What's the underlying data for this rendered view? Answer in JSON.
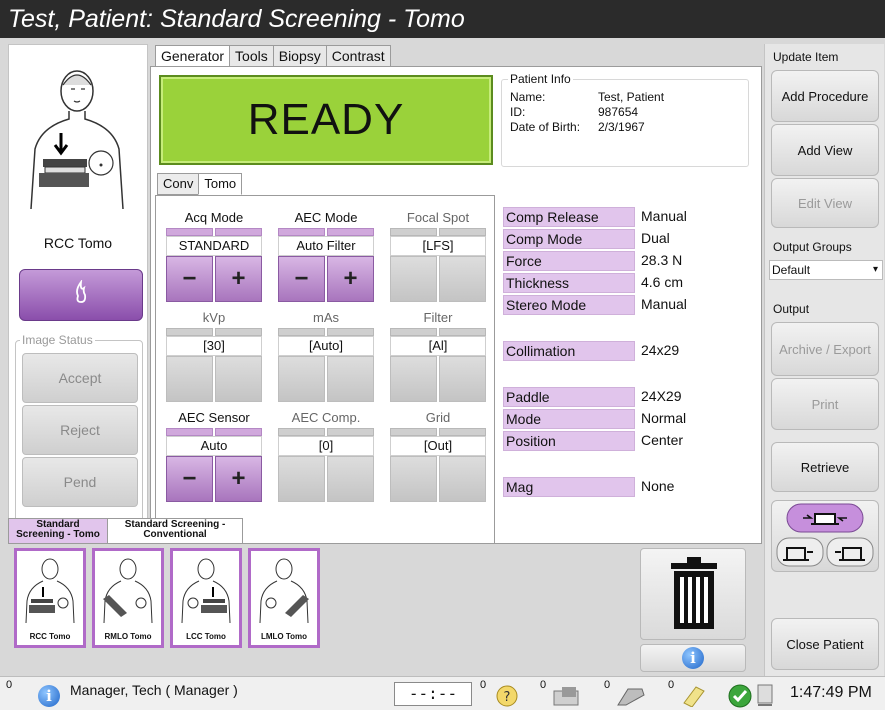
{
  "window": {
    "title": "Test, Patient:  Standard Screening - Tomo"
  },
  "left": {
    "view_name": "RCC Tomo",
    "image_status_label": "Image Status",
    "accept_label": "Accept",
    "reject_label": "Reject",
    "pend_label": "Pend",
    "view_icon": "breast-compression-figure-icon",
    "purple_button_icon": "flame-icon"
  },
  "tabs": [
    "Generator",
    "Tools",
    "Biopsy",
    "Contrast"
  ],
  "ready_text": "READY",
  "patient_info": {
    "legend": "Patient Info",
    "name_label": "Name:",
    "name": "Test, Patient",
    "id_label": "ID:",
    "id": "987654",
    "dob_label": "Date of Birth:",
    "dob": "2/3/1967"
  },
  "subtabs": [
    "Conv",
    "Tomo"
  ],
  "controls": {
    "acq_mode": {
      "label": "Acq Mode",
      "value": "STANDARD"
    },
    "aec_mode": {
      "label": "AEC Mode",
      "value": "Auto Filter"
    },
    "focal_spot": {
      "label": "Focal Spot",
      "value": "[LFS]"
    },
    "kvp": {
      "label": "kVp",
      "value": "[30]"
    },
    "mas": {
      "label": "mAs",
      "value": "[Auto]"
    },
    "filter": {
      "label": "Filter",
      "value": "[Al]"
    },
    "aec_sensor": {
      "label": "AEC Sensor",
      "value": "Auto"
    },
    "aec_comp": {
      "label": "AEC Comp.",
      "value": "[0]"
    },
    "grid": {
      "label": "Grid",
      "value": "[Out]"
    },
    "minus": "−",
    "plus": "+"
  },
  "settings": {
    "comp_release": {
      "k": "Comp Release",
      "v": "Manual"
    },
    "comp_mode": {
      "k": "Comp Mode",
      "v": "Dual"
    },
    "force": {
      "k": "Force",
      "v": "28.3 N"
    },
    "thickness": {
      "k": "Thickness",
      "v": "4.6 cm"
    },
    "stereo_mode": {
      "k": "Stereo Mode",
      "v": "Manual"
    },
    "collimation": {
      "k": "Collimation",
      "v": "24x29"
    },
    "paddle": {
      "k": "Paddle",
      "v": "24X29"
    },
    "mode": {
      "k": "Mode",
      "v": "Normal"
    },
    "position": {
      "k": "Position",
      "v": "Center"
    },
    "mag": {
      "k": "Mag",
      "v": "None"
    }
  },
  "right": {
    "update_item": "Update Item",
    "add_procedure": "Add Procedure",
    "add_view": "Add View",
    "edit_view": "Edit View",
    "output_groups": "Output Groups",
    "output_group_selected": "Default",
    "output": "Output",
    "archive_export": "Archive / Export",
    "print": "Print",
    "retrieve": "Retrieve",
    "close_patient": "Close Patient"
  },
  "procedure_tabs": [
    "Standard Screening - Tomo",
    "Standard Screening - Conventional"
  ],
  "thumbnails": [
    "RCC Tomo",
    "RMLO Tomo",
    "LCC Tomo",
    "LMLO Tomo"
  ],
  "status": {
    "alarm_count": "0",
    "user": "Manager, Tech ( Manager )",
    "timer": "--:--",
    "count1": "0",
    "count2": "0",
    "count3": "0",
    "count4": "0",
    "time": "1:47:49 PM"
  },
  "colors": {
    "accent_purple": "#b06ac8",
    "ready_green": "#9ad23a",
    "title_bg": "#2b2b2b"
  }
}
